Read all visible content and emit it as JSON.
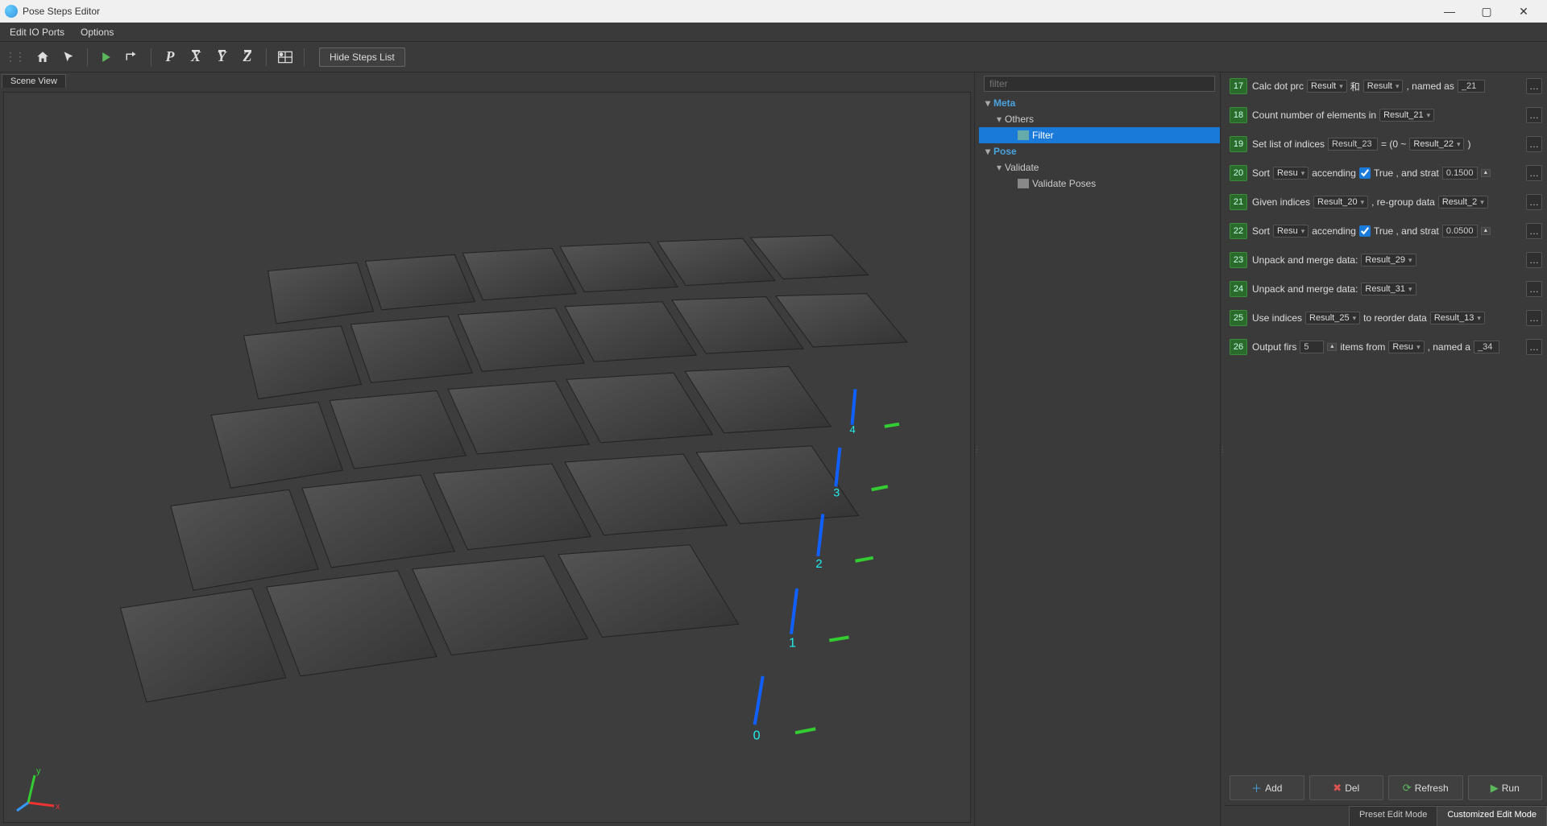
{
  "window": {
    "title": "Pose Steps Editor"
  },
  "menu": {
    "editPorts": "Edit IO Ports",
    "options": "Options"
  },
  "toolbar": {
    "hideSteps": "Hide Steps List"
  },
  "sceneTab": "Scene View",
  "tree": {
    "filterPlaceholder": "filter",
    "meta": "Meta",
    "others": "Others",
    "filter": "Filter",
    "pose": "Pose",
    "validate": "Validate",
    "validatePoses": "Validate Poses"
  },
  "steps": [
    {
      "num": "17",
      "t1": "Calc dot prc",
      "s1": "Result",
      "t2": "和",
      "s2": "Result",
      "t3": ", named as",
      "v": "_21"
    },
    {
      "num": "18",
      "t1": "Count number of elements in",
      "s1": "Result_21"
    },
    {
      "num": "19",
      "t1": "Set list of indices",
      "v1": "Result_23",
      "t2": "= (0 ~",
      "s1": "Result_22",
      "t3": ")"
    },
    {
      "num": "20",
      "t1": "Sort",
      "s1": "Resu",
      "t2": "accending",
      "chk": true,
      "t3": "True  , and strat",
      "v": "0.1500"
    },
    {
      "num": "21",
      "t1": "Given indices",
      "s1": "Result_20",
      "t2": ", re-group data",
      "s2": "Result_2"
    },
    {
      "num": "22",
      "t1": "Sort",
      "s1": "Resu",
      "t2": "accending",
      "chk": true,
      "t3": "True  , and strat",
      "v": "0.0500"
    },
    {
      "num": "23",
      "t1": "Unpack and merge data:",
      "s1": "Result_29"
    },
    {
      "num": "24",
      "t1": "Unpack and merge data:",
      "s1": "Result_31"
    },
    {
      "num": "25",
      "t1": "Use indices",
      "s1": "Result_25",
      "t2": "to reorder data",
      "s2": "Result_13"
    },
    {
      "num": "26",
      "t1": "Output firs",
      "v1": "5",
      "t2": "items from",
      "s1": "Resu",
      "t3": ", named a",
      "v2": "_34"
    }
  ],
  "buttons": {
    "add": "Add",
    "del": "Del",
    "refresh": "Refresh",
    "run": "Run"
  },
  "modes": {
    "preset": "Preset Edit Mode",
    "custom": "Customized Edit Mode"
  },
  "pose_labels": [
    "0",
    "1",
    "2",
    "3",
    "4"
  ]
}
